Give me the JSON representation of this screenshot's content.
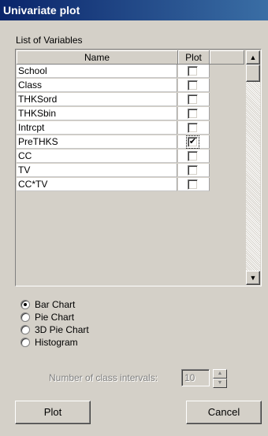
{
  "window": {
    "title": "Univariate plot"
  },
  "variables": {
    "group_label": "List of Variables",
    "columns": {
      "name": "Name",
      "plot": "Plot"
    },
    "rows": [
      {
        "name": "School",
        "plot": false
      },
      {
        "name": "Class",
        "plot": false
      },
      {
        "name": "THKSord",
        "plot": false
      },
      {
        "name": "THKSbin",
        "plot": false
      },
      {
        "name": "Intrcpt",
        "plot": false
      },
      {
        "name": "PreTHKS",
        "plot": true
      },
      {
        "name": "CC",
        "plot": false
      },
      {
        "name": "TV",
        "plot": false
      },
      {
        "name": "CC*TV",
        "plot": false
      }
    ],
    "scroll_up_icon": "triangle-up-icon",
    "scroll_down_icon": "triangle-down-icon"
  },
  "chart_type": {
    "options": [
      "Bar Chart",
      "Pie Chart",
      "3D Pie Chart",
      "Histogram"
    ],
    "selected": "Bar Chart"
  },
  "intervals": {
    "label": "Number of class intervals:",
    "value": "10",
    "enabled": false
  },
  "buttons": {
    "plot": "Plot",
    "cancel": "Cancel"
  },
  "check_mark": "✔"
}
